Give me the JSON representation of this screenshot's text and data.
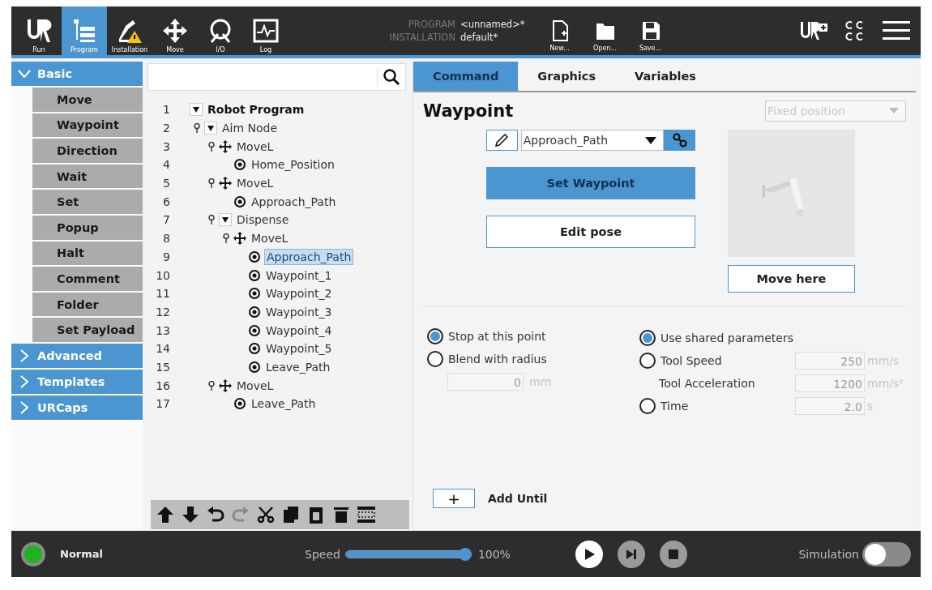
{
  "top_bar": {
    "nav": [
      {
        "label": "Run",
        "kind": "run",
        "selected": false,
        "warning": false
      },
      {
        "label": "Program",
        "kind": "program",
        "selected": true,
        "warning": false
      },
      {
        "label": "Installation",
        "kind": "installation",
        "selected": false,
        "warning": true
      },
      {
        "label": "Move",
        "kind": "move",
        "selected": false,
        "warning": false
      },
      {
        "label": "I/O",
        "kind": "io",
        "selected": false,
        "warning": false
      },
      {
        "label": "Log",
        "kind": "log",
        "selected": false,
        "warning": false
      }
    ],
    "program": {
      "label": "PROGRAM",
      "value": "<unnamed>*"
    },
    "installation": {
      "label": "INSTALLATION",
      "value": "default*"
    },
    "file_buttons": [
      {
        "label": "New...",
        "kind": "new"
      },
      {
        "label": "Open...",
        "kind": "open"
      },
      {
        "label": "Save...",
        "kind": "save"
      }
    ]
  },
  "sidebar": {
    "sections": [
      {
        "label": "Basic",
        "expanded": true,
        "items": [
          "Move",
          "Waypoint",
          "Direction",
          "Wait",
          "Set",
          "Popup",
          "Halt",
          "Comment",
          "Folder",
          "Set Payload"
        ]
      },
      {
        "label": "Advanced",
        "expanded": false
      },
      {
        "label": "Templates",
        "expanded": false
      },
      {
        "label": "URCaps",
        "expanded": false
      }
    ]
  },
  "tree": {
    "nodes": [
      {
        "line": "1",
        "label": "Robot Program",
        "kind": "root",
        "expanded": true,
        "selected": false,
        "children": [
          {
            "line": "2",
            "label": "Aim Node",
            "kind": "folder",
            "expanded": true,
            "selected": false,
            "children": [
              {
                "line": "3",
                "label": "MoveL",
                "kind": "move",
                "selected": false,
                "children": [
                  {
                    "line": "4",
                    "label": "Home_Position",
                    "kind": "waypoint",
                    "selected": false
                  }
                ]
              },
              {
                "line": "5",
                "label": "MoveL",
                "kind": "move",
                "selected": false,
                "children": [
                  {
                    "line": "6",
                    "label": "Approach_Path",
                    "kind": "waypoint",
                    "selected": false
                  }
                ]
              },
              {
                "line": "7",
                "label": "Dispense",
                "kind": "folder",
                "expanded": true,
                "selected": false,
                "children": [
                  {
                    "line": "8",
                    "label": "MoveL",
                    "kind": "move",
                    "selected": false,
                    "children": [
                      {
                        "line": "9",
                        "label": "Approach_Path",
                        "kind": "waypoint",
                        "selected": true
                      },
                      {
                        "line": "10",
                        "label": "Waypoint_1",
                        "kind": "waypoint",
                        "selected": false
                      },
                      {
                        "line": "11",
                        "label": "Waypoint_2",
                        "kind": "waypoint",
                        "selected": false
                      },
                      {
                        "line": "12",
                        "label": "Waypoint_3",
                        "kind": "waypoint",
                        "selected": false
                      },
                      {
                        "line": "13",
                        "label": "Waypoint_4",
                        "kind": "waypoint",
                        "selected": false
                      },
                      {
                        "line": "14",
                        "label": "Waypoint_5",
                        "kind": "waypoint",
                        "selected": false
                      },
                      {
                        "line": "15",
                        "label": "Leave_Path",
                        "kind": "waypoint",
                        "selected": false
                      }
                    ]
                  }
                ]
              },
              {
                "line": "16",
                "label": "MoveL",
                "kind": "move",
                "selected": false,
                "children": [
                  {
                    "line": "17",
                    "label": "Leave_Path",
                    "kind": "waypoint",
                    "selected": false
                  }
                ]
              }
            ]
          }
        ]
      }
    ],
    "toolbar": [
      {
        "kind": "up",
        "disabled": false
      },
      {
        "kind": "down",
        "disabled": false
      },
      {
        "kind": "undo",
        "disabled": false
      },
      {
        "kind": "redo",
        "disabled": true
      },
      {
        "kind": "cut",
        "disabled": false
      },
      {
        "kind": "copy",
        "disabled": false
      },
      {
        "kind": "paste",
        "disabled": false
      },
      {
        "kind": "delete",
        "disabled": false
      },
      {
        "kind": "suppress",
        "disabled": false
      }
    ]
  },
  "command": {
    "tabs": [
      {
        "label": "Command",
        "selected": true
      },
      {
        "label": "Graphics",
        "selected": false
      },
      {
        "label": "Variables",
        "selected": false
      }
    ],
    "title": "Waypoint",
    "position_mode": {
      "value": "Fixed position",
      "disabled": true
    },
    "waypoint_name": "Approach_Path",
    "set_button": "Set Waypoint",
    "edit_button": "Edit pose",
    "move_button": "Move here",
    "stop_options": [
      {
        "label": "Stop at this point",
        "selected": true
      },
      {
        "label": "Blend with radius",
        "selected": false
      }
    ],
    "blend_radius": {
      "value": "0",
      "unit": "mm",
      "disabled": true
    },
    "params": [
      {
        "label": "Use shared parameters",
        "kind": "radio",
        "selected": true
      },
      {
        "label": "Tool Speed",
        "kind": "radio",
        "selected": false,
        "value": "250",
        "unit": "mm/s",
        "disabled": true
      },
      {
        "label": "Tool Acceleration",
        "kind": "plain",
        "value": "1200",
        "unit": "mm/s²",
        "disabled": true
      },
      {
        "label": "Time",
        "kind": "radio",
        "selected": false,
        "value": "2.0",
        "unit": "s",
        "disabled": true
      }
    ],
    "add_until": {
      "symbol": "+",
      "label": "Add Until"
    }
  },
  "footer": {
    "status": {
      "label": "Normal",
      "color": "#1fb41f"
    },
    "speed": {
      "label": "Speed",
      "level": 1,
      "reading": "100%"
    },
    "controls": [
      {
        "kind": "play",
        "disabled": false
      },
      {
        "kind": "step",
        "disabled": true
      },
      {
        "kind": "stop",
        "disabled": true
      }
    ],
    "simulation": {
      "label": "Simulation",
      "on": false
    }
  }
}
